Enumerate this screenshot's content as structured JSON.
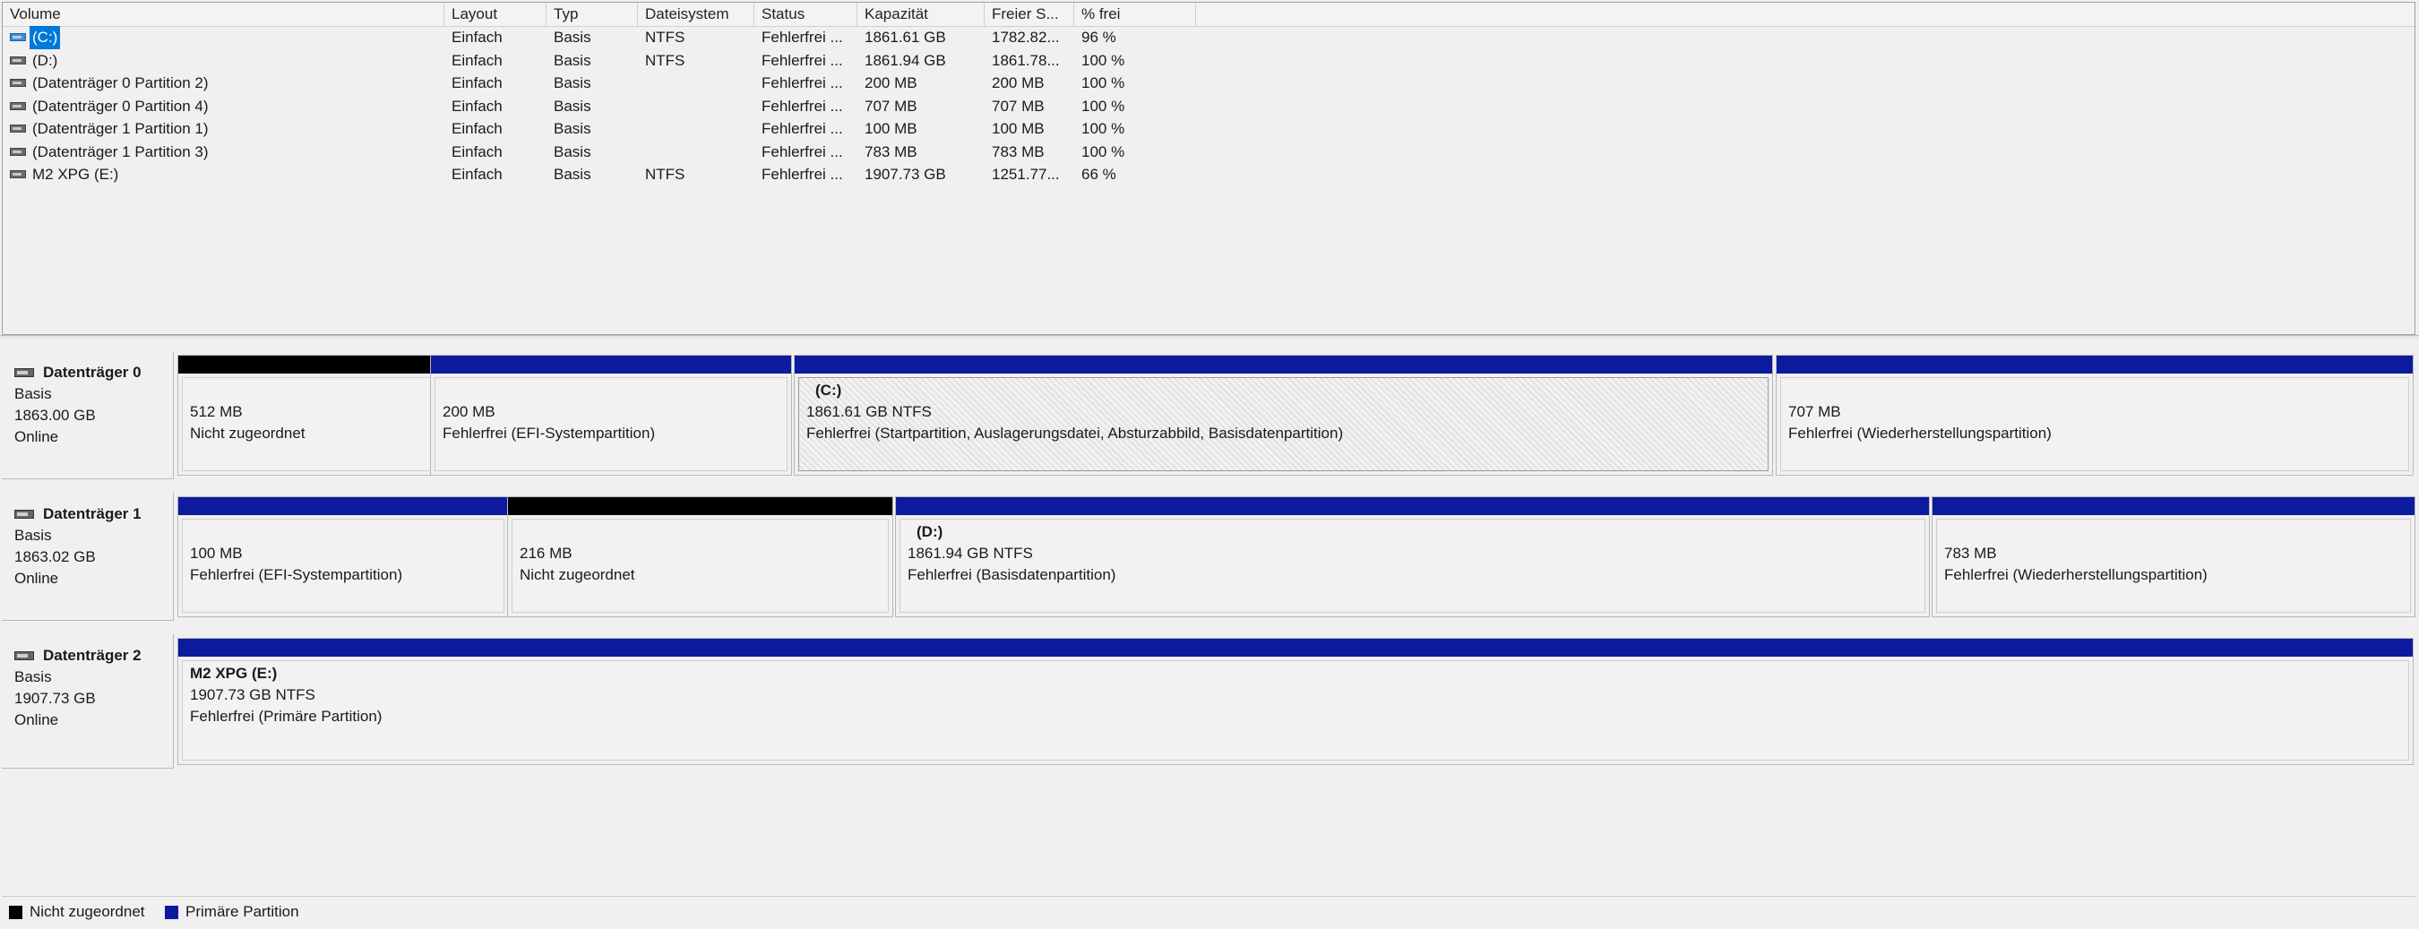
{
  "volume_list": {
    "columns": [
      "Volume",
      "Layout",
      "Typ",
      "Dateisystem",
      "Status",
      "Kapazität",
      "Freier S...",
      "% frei",
      ""
    ],
    "rows": [
      {
        "volume": "(C:)",
        "layout": "Einfach",
        "typ": "Basis",
        "dateisystem": "NTFS",
        "status": "Fehlerfrei ...",
        "kapazitaet": "1861.61 GB",
        "frei": "1782.82...",
        "prozent": "96 %",
        "icon": "system-drive-icon"
      },
      {
        "volume": "(D:)",
        "layout": "Einfach",
        "typ": "Basis",
        "dateisystem": "NTFS",
        "status": "Fehlerfrei ...",
        "kapazitaet": "1861.94 GB",
        "frei": "1861.78...",
        "prozent": "100 %",
        "icon": "drive-icon"
      },
      {
        "volume": "(Datenträger 0 Partition 2)",
        "layout": "Einfach",
        "typ": "Basis",
        "dateisystem": "",
        "status": "Fehlerfrei ...",
        "kapazitaet": "200 MB",
        "frei": "200 MB",
        "prozent": "100 %",
        "icon": "drive-icon"
      },
      {
        "volume": "(Datenträger 0 Partition 4)",
        "layout": "Einfach",
        "typ": "Basis",
        "dateisystem": "",
        "status": "Fehlerfrei ...",
        "kapazitaet": "707 MB",
        "frei": "707 MB",
        "prozent": "100 %",
        "icon": "drive-icon"
      },
      {
        "volume": "(Datenträger 1 Partition 1)",
        "layout": "Einfach",
        "typ": "Basis",
        "dateisystem": "",
        "status": "Fehlerfrei ...",
        "kapazitaet": "100 MB",
        "frei": "100 MB",
        "prozent": "100 %",
        "icon": "drive-icon"
      },
      {
        "volume": "(Datenträger 1 Partition 3)",
        "layout": "Einfach",
        "typ": "Basis",
        "dateisystem": "",
        "status": "Fehlerfrei ...",
        "kapazitaet": "783 MB",
        "frei": "783 MB",
        "prozent": "100 %",
        "icon": "drive-icon"
      },
      {
        "volume": "M2 XPG (E:)",
        "layout": "Einfach",
        "typ": "Basis",
        "dateisystem": "NTFS",
        "status": "Fehlerfrei ...",
        "kapazitaet": "1907.73 GB",
        "frei": "1251.77...",
        "prozent": "66 %",
        "icon": "drive-icon"
      }
    ]
  },
  "disks": [
    {
      "title": "Datenträger 0",
      "type": "Basis",
      "size": "1863.00 GB",
      "state": "Online",
      "partitions": [
        {
          "kind": "unalloc",
          "name": "",
          "line1": "512 MB",
          "line2": "Nicht zugeordnet"
        },
        {
          "kind": "primary",
          "name": "",
          "line1": "200 MB",
          "line2": "Fehlerfrei (EFI-Systempartition)"
        },
        {
          "kind": "primary",
          "name": "(C:)",
          "line1": "1861.61 GB NTFS",
          "line2": "Fehlerfrei (Startpartition, Auslagerungsdatei, Absturzabbild, Basisdatenpartition)",
          "selected": true
        },
        {
          "kind": "primary",
          "name": "",
          "line1": "707 MB",
          "line2": "Fehlerfrei (Wiederherstellungspartition)"
        }
      ]
    },
    {
      "title": "Datenträger 1",
      "type": "Basis",
      "size": "1863.02 GB",
      "state": "Online",
      "partitions": [
        {
          "kind": "primary",
          "name": "",
          "line1": "100 MB",
          "line2": "Fehlerfrei (EFI-Systempartition)"
        },
        {
          "kind": "unalloc",
          "name": "",
          "line1": "216 MB",
          "line2": "Nicht zugeordnet"
        },
        {
          "kind": "primary",
          "name": "(D:)",
          "line1": "1861.94 GB NTFS",
          "line2": "Fehlerfrei (Basisdatenpartition)"
        },
        {
          "kind": "primary",
          "name": "",
          "line1": "783 MB",
          "line2": "Fehlerfrei (Wiederherstellungspartition)"
        }
      ]
    },
    {
      "title": "Datenträger 2",
      "type": "Basis",
      "size": "1907.73 GB",
      "state": "Online",
      "partitions": [
        {
          "kind": "primary",
          "name": "M2 XPG  (E:)",
          "line1": "1907.73 GB NTFS",
          "line2": "Fehlerfrei (Primäre Partition)"
        }
      ]
    }
  ],
  "legend": [
    {
      "label": "Nicht zugeordnet",
      "color": "#000000"
    },
    {
      "label": "Primäre Partition",
      "color": "#0c1a9e"
    }
  ]
}
